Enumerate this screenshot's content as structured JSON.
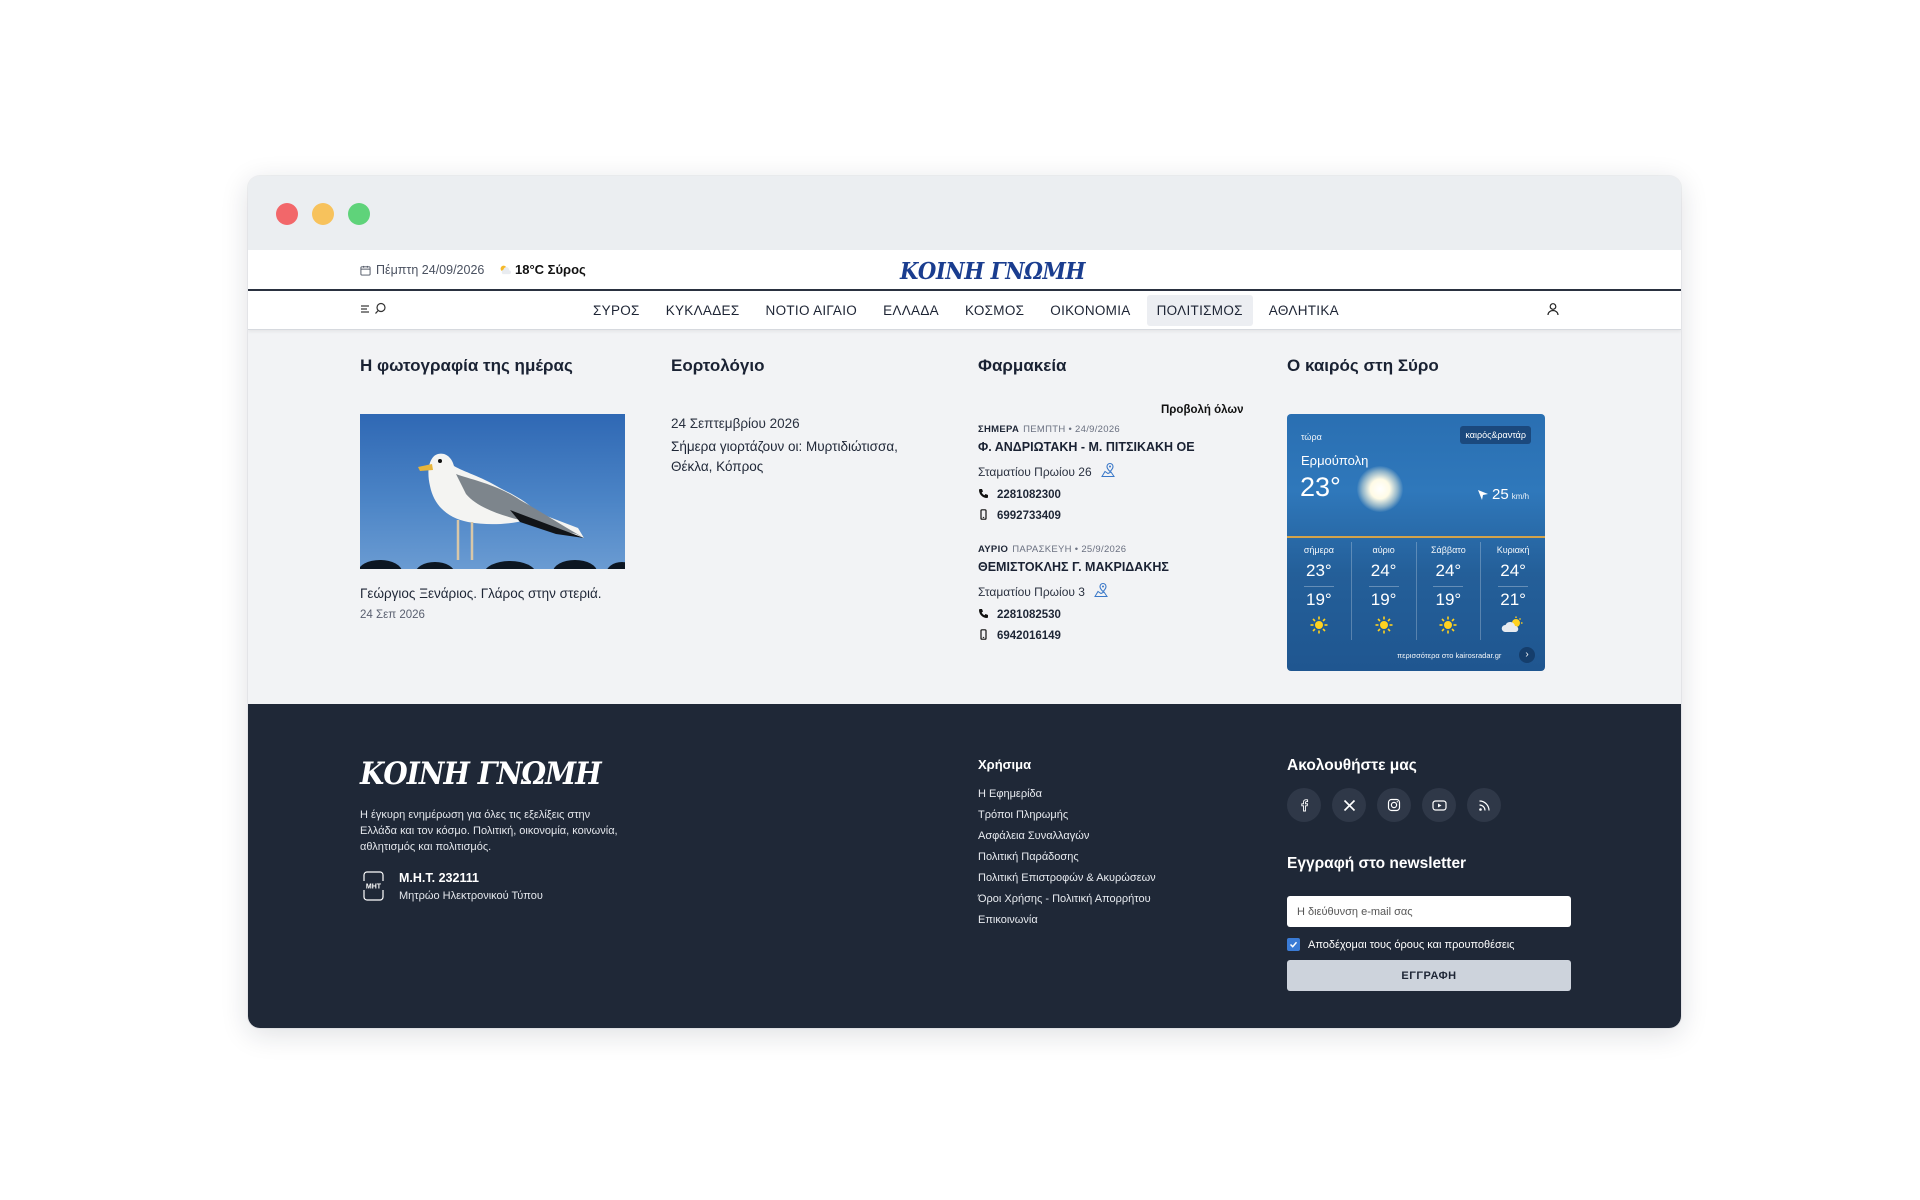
{
  "topbar": {
    "date": "Πέμπτη 24/09/2026",
    "weather": "18°C Σύρος",
    "logo": "ΚΟΙΝΗ ΓΝΩΜΗ"
  },
  "nav": {
    "items": [
      "ΣΥΡΟΣ",
      "ΚΥΚΛΑΔΕΣ",
      "ΝΟΤΙΟ ΑΙΓΑΙΟ",
      "ΕΛΛΑΔΑ",
      "ΚΟΣΜΟΣ",
      "ΟΙΚΟΝΟΜΙΑ",
      "ΠΟΛΙΤΙΣΜΟΣ",
      "ΑΘΛΗΤΙΚΑ"
    ],
    "active": "ΠΟΛΙΤΙΣΜΟΣ"
  },
  "photo": {
    "title": "Η φωτογραφία της ημέρας",
    "caption": "Γεώργιος Ξενάριος. Γλάρος στην στεριά.",
    "date": "24 Σεπ 2026"
  },
  "feasts": {
    "title": "Εορτολόγιο",
    "date": "24 Σεπτεμβρίου 2026",
    "text": "Σήμερα γιορτάζουν οι: Μυρτιδιώτισσα, Θέκλα, Κόπρος"
  },
  "pharmacies": {
    "title": "Φαρμακεία",
    "view_all": "Προβολή όλων",
    "items": [
      {
        "day": "ΣΗΜΕΡΑ",
        "date": "ΠΕΜΠΤΗ • 24/9/2026",
        "name": "Φ. ΑΝΔΡΙΩΤΑΚΗ - Μ. ΠΙΤΣΙΚΑΚΗ ΟΕ",
        "address": "Σταματίου Πρωίου 26",
        "phone": "2281082300",
        "mobile": "6992733409"
      },
      {
        "day": "ΑΥΡΙΟ",
        "date": "ΠΑΡΑΣΚΕΥΗ • 25/9/2026",
        "name": "ΘΕΜΙΣΤΟΚΛΗΣ Γ. ΜΑΚΡΙΔΑΚΗΣ",
        "address": "Σταματίου Πρωίου 3",
        "phone": "2281082530",
        "mobile": "6942016149"
      }
    ]
  },
  "weather": {
    "title": "Ο καιρός στη Σύρο",
    "now_label": "τώρα",
    "badge": "καιρός&ραντάρ",
    "city": "Ερμούπολη",
    "temp": "23°",
    "wind": "25",
    "wind_unit": "km/h",
    "days": [
      {
        "name": "σήμερα",
        "high": "23°",
        "low": "19°",
        "icon": "sun-icon"
      },
      {
        "name": "αύριο",
        "high": "24°",
        "low": "19°",
        "icon": "sun-icon"
      },
      {
        "name": "Σάββατο",
        "high": "24°",
        "low": "19°",
        "icon": "sun-icon"
      },
      {
        "name": "Κυριακή",
        "high": "24°",
        "low": "21°",
        "icon": "partly-cloudy-icon"
      }
    ],
    "more": "περισσότερα στο kairosradar.gr"
  },
  "footer": {
    "logo": "ΚΟΙΝΗ ΓΝΩΜΗ",
    "description": "Η έγκυρη ενημέρωση για όλες τις εξελίξεις στην Ελλάδα και τον κόσμο. Πολιτική, οικονομία, κοινωνία, αθλητισμός και πολιτισμός.",
    "mht_title": "Μ.Η.Τ. 232111",
    "mht_sub": "Μητρώο Ηλεκτρονικού Τύπου",
    "mht_icon_text": "ΜΗΤ",
    "useful_title": "Χρήσιμα",
    "useful_links": [
      "Η Εφημερίδα",
      "Τρόποι Πληρωμής",
      "Ασφάλεια Συναλλαγών",
      "Πολιτική Παράδοσης",
      "Πολιτική Επιστροφών & Ακυρώσεων",
      "Όροι Χρήσης - Πολιτική Απορρήτου",
      "Επικοινωνία"
    ],
    "follow_title": "Ακολουθήστε μας",
    "newsletter_title": "Εγγραφή στο newsletter",
    "email_placeholder": "Η διεύθυνση e-mail σας",
    "terms": "Αποδέχομαι τους όρους και προυποθέσεις",
    "submit": "ΕΓΓΡΑΦΗ"
  },
  "colors": {
    "brand": "#1a3d8f",
    "footer_bg": "#1f2837",
    "weather_card": "#2a6fb2"
  }
}
